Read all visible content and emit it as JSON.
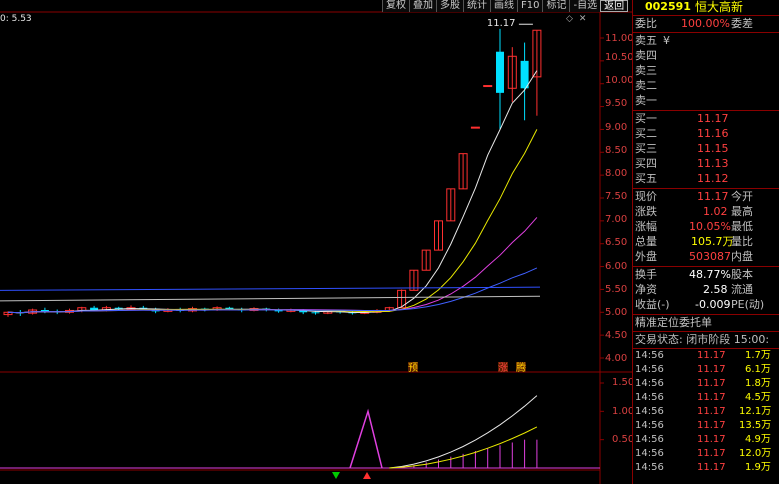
{
  "toolbar": {
    "buttons": [
      "复权",
      "叠加",
      "多股",
      "统计",
      "画线",
      "F10",
      "标记",
      "-自选",
      "返回"
    ]
  },
  "ma_scale_label": "0: 5.53",
  "price_axis": [
    "11.00",
    "10.50",
    "10.00",
    "9.50",
    "9.00",
    "8.50",
    "8.00",
    "7.50",
    "7.00",
    "6.50",
    "6.00",
    "5.50",
    "5.00",
    "4.50",
    "4.00"
  ],
  "indicator_axis": [
    "1.50",
    "1.00",
    "0.50"
  ],
  "high_annotation": "11.17",
  "candle_markers": [
    {
      "text": "预",
      "color": "#ffcc00"
    },
    {
      "text": "涨",
      "color": "#ff4040"
    },
    {
      "text": "腾",
      "color": "#ffcc00"
    }
  ],
  "arrows": {
    "down_color": "#00cc00",
    "up_color": "#ff3030"
  },
  "colors": {
    "accent_red": "#ff4040",
    "up_red": "#ff3030",
    "down_cyan": "#00e0ff",
    "volume_yellow": "#ffff00",
    "divider": "#8a0000"
  },
  "quote": {
    "code": "002591",
    "name": "恒大高新",
    "weibi_label": "委比",
    "weibi_value": "100.00%",
    "weicha_label": "委差",
    "sell": [
      {
        "label": "卖五",
        "price": "¥",
        "vol": ""
      },
      {
        "label": "卖四",
        "price": "",
        "vol": ""
      },
      {
        "label": "卖三",
        "price": "",
        "vol": ""
      },
      {
        "label": "卖二",
        "price": "",
        "vol": ""
      },
      {
        "label": "卖一",
        "price": "",
        "vol": ""
      }
    ],
    "buy": [
      {
        "label": "买一",
        "price": "11.17"
      },
      {
        "label": "买二",
        "price": "11.16"
      },
      {
        "label": "买三",
        "price": "11.15"
      },
      {
        "label": "买四",
        "price": "11.13"
      },
      {
        "label": "买五",
        "price": "11.12"
      }
    ],
    "stats": [
      {
        "l1": "现价",
        "v1": "11.17",
        "l2": "今开"
      },
      {
        "l1": "涨跌",
        "v1": "1.02",
        "l2": "最高"
      },
      {
        "l1": "涨幅",
        "v1": "10.05%",
        "l2": "最低"
      },
      {
        "l1": "总量",
        "v1": "105.7万",
        "l2": "量比"
      },
      {
        "l1": "外盘",
        "v1": "503087",
        "l2": "内盘"
      },
      {
        "l1": "换手",
        "v1": "48.77%",
        "l2": "股本"
      },
      {
        "l1": "净资",
        "v1": "2.58",
        "l2": "流通"
      },
      {
        "l1": "收益(-)",
        "v1": "-0.009",
        "l2": "PE(动)"
      }
    ],
    "order_title": "精准定位委托单",
    "trade_status": "交易状态: 闭市阶段 15:00:",
    "ticks": [
      {
        "time": "14:56",
        "price": "11.17",
        "vol": "1.7万"
      },
      {
        "time": "14:56",
        "price": "11.17",
        "vol": "6.1万"
      },
      {
        "time": "14:56",
        "price": "11.17",
        "vol": "1.8万"
      },
      {
        "time": "14:56",
        "price": "11.17",
        "vol": "4.5万"
      },
      {
        "time": "14:56",
        "price": "11.17",
        "vol": "12.1万"
      },
      {
        "time": "14:56",
        "price": "11.17",
        "vol": "13.5万"
      },
      {
        "time": "14:56",
        "price": "11.17",
        "vol": "4.9万"
      },
      {
        "time": "14:56",
        "price": "11.17",
        "vol": "12.0万"
      },
      {
        "time": "14:56",
        "price": "11.17",
        "vol": "1.9万"
      }
    ]
  },
  "chart_data": {
    "type": "candlestick",
    "ylim": [
      3.9,
      11.3
    ],
    "candles": [
      [
        4.95,
        5.0,
        4.9,
        5.02
      ],
      [
        5.0,
        4.98,
        4.92,
        5.05
      ],
      [
        4.98,
        5.05,
        4.95,
        5.08
      ],
      [
        5.05,
        5.02,
        4.98,
        5.1
      ],
      [
        5.02,
        5.0,
        4.96,
        5.06
      ],
      [
        5.0,
        5.04,
        4.97,
        5.08
      ],
      [
        5.04,
        5.1,
        5.0,
        5.12
      ],
      [
        5.1,
        5.05,
        5.02,
        5.14
      ],
      [
        5.05,
        5.1,
        5.02,
        5.14
      ],
      [
        5.1,
        5.06,
        5.03,
        5.12
      ],
      [
        5.06,
        5.1,
        5.04,
        5.15
      ],
      [
        5.1,
        5.08,
        5.05,
        5.14
      ],
      [
        5.08,
        5.02,
        4.98,
        5.1
      ],
      [
        5.02,
        5.06,
        5.0,
        5.09
      ],
      [
        5.06,
        5.03,
        5.0,
        5.1
      ],
      [
        5.03,
        5.08,
        5.0,
        5.12
      ],
      [
        5.08,
        5.05,
        5.02,
        5.1
      ],
      [
        5.05,
        5.1,
        5.03,
        5.13
      ],
      [
        5.1,
        5.06,
        5.04,
        5.12
      ],
      [
        5.06,
        5.04,
        5.0,
        5.1
      ],
      [
        5.04,
        5.08,
        5.02,
        5.11
      ],
      [
        5.08,
        5.05,
        5.02,
        5.1
      ],
      [
        5.05,
        5.02,
        4.99,
        5.08
      ],
      [
        5.02,
        5.05,
        5.0,
        5.08
      ],
      [
        5.05,
        5.0,
        4.96,
        5.07
      ],
      [
        5.0,
        4.98,
        4.95,
        5.03
      ],
      [
        4.98,
        5.02,
        4.96,
        5.05
      ],
      [
        5.02,
        5.0,
        4.97,
        5.04
      ],
      [
        5.0,
        4.98,
        4.95,
        5.02
      ],
      [
        4.98,
        5.0,
        4.96,
        5.04
      ],
      [
        5.0,
        5.04,
        4.98,
        5.07
      ],
      [
        5.04,
        5.1,
        5.02,
        5.12
      ],
      [
        5.1,
        5.48,
        5.1,
        5.5
      ],
      [
        5.48,
        5.92,
        5.48,
        5.92
      ],
      [
        5.92,
        6.36,
        5.92,
        6.36
      ],
      [
        6.36,
        7.0,
        6.36,
        7.0
      ],
      [
        7.0,
        7.7,
        7.0,
        7.7
      ],
      [
        7.7,
        8.47,
        7.7,
        8.47
      ],
      [
        9.05,
        9.05,
        9.05,
        9.05
      ],
      [
        9.96,
        9.96,
        9.96,
        9.96
      ],
      [
        10.7,
        9.8,
        9.0,
        11.2
      ],
      [
        9.9,
        10.6,
        9.6,
        10.8
      ],
      [
        10.5,
        9.9,
        9.2,
        10.9
      ],
      [
        10.15,
        11.17,
        9.3,
        11.17
      ]
    ]
  }
}
